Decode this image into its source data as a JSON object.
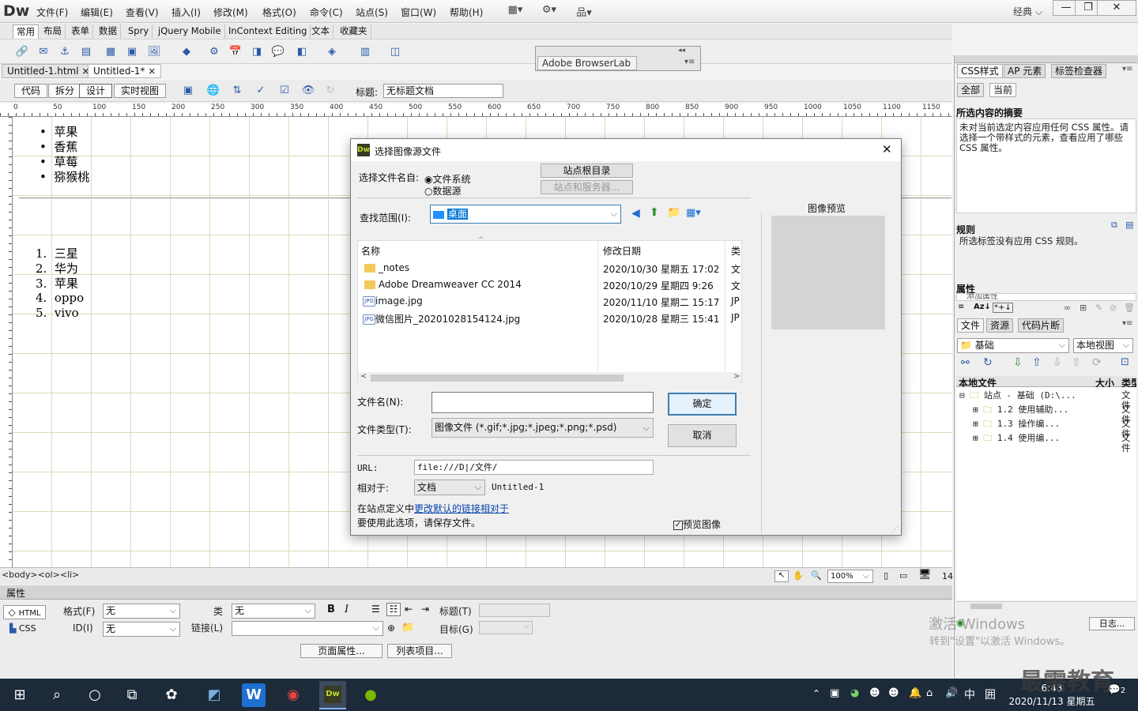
{
  "app": {
    "logo": "Dw",
    "menu": [
      "文件(F)",
      "编辑(E)",
      "查看(V)",
      "插入(I)",
      "修改(M)",
      "格式(O)",
      "命令(C)",
      "站点(S)",
      "窗口(W)",
      "帮助(H)"
    ],
    "workspace": "经典",
    "win_min": "—",
    "win_max": "❐",
    "win_close": "✕"
  },
  "insert_tabs": [
    "常用",
    "布局",
    "表单",
    "数据",
    "Spry",
    "jQuery Mobile",
    "InContext Editing",
    "文本",
    "收藏夹"
  ],
  "doc_tabs": [
    {
      "label": "Untitled-1.html",
      "close": "×"
    },
    {
      "label": "Untitled-1*",
      "close": "×"
    }
  ],
  "view_buttons": [
    "代码",
    "拆分",
    "设计",
    "实时视图"
  ],
  "title_label": "标题:",
  "title_value": "无标题文档",
  "ruler_labels": [
    "0",
    "50",
    "100",
    "150",
    "200",
    "250",
    "300",
    "350",
    "400",
    "450",
    "500",
    "550",
    "600",
    "650",
    "700",
    "750",
    "800",
    "850",
    "900",
    "950",
    "1000",
    "1050",
    "1100",
    "1150"
  ],
  "browserlab": {
    "title": "Adobe BrowserLab",
    "collapse": "◂◂",
    "menu": "▾≡"
  },
  "doc": {
    "ul": [
      "苹果",
      "香蕉",
      "草莓",
      "猕猴桃"
    ],
    "ol": [
      "三星",
      "华为",
      "苹果",
      "oppo",
      "vivo"
    ]
  },
  "status": {
    "tagpath": "<body><ol><li>",
    "zoom": "100%",
    "size": "14"
  },
  "props": {
    "header": "属性",
    "html_btn": "HTML",
    "css_btn": "CSS",
    "format_label": "格式(F)",
    "format_value": "无",
    "id_label": "ID(I)",
    "id_value": "无",
    "class_label": "类",
    "class_value": "无",
    "link_label": "链接(L)",
    "link_value": "",
    "title_label": "标题(T)",
    "target_label": "目标(G)",
    "bold": "B",
    "italic": "I",
    "page_props": "页面属性...",
    "list_item": "列表项目..."
  },
  "right": {
    "css_tabs": [
      "CSS样式",
      "AP 元素",
      "标签检查器"
    ],
    "mode_tabs": [
      "全部",
      "当前"
    ],
    "summary_head": "所选内容的摘要",
    "summary_text": "未对当前选定内容应用任何 CSS 属性。请选择一个带样式的元素，查看应用了哪些 CSS 属性。",
    "rules_head": "规则",
    "rules_text": "所选标签没有应用 CSS 规则。",
    "attr_head": "属性",
    "attr_add": "添加属性",
    "files_tabs": [
      "文件",
      "资源",
      "代码片断"
    ],
    "site_select": "基础",
    "view_select": "本地视图",
    "local_files": "本地文件",
    "size_col": "大小",
    "type_col": "类型",
    "tree": [
      {
        "name": "站点 - 基础 (D:\\...",
        "type": "文件"
      },
      {
        "name": "1.2 使用辅助...",
        "type": "文件"
      },
      {
        "name": "1.3 操作编...",
        "type": "文件"
      },
      {
        "name": "1.4 使用编...",
        "type": "文件"
      }
    ],
    "log": "日志..."
  },
  "dialog": {
    "title": "选择图像源文件",
    "close": "✕",
    "select_label": "选择文件名自:",
    "opt_fs": "文件系统",
    "opt_ds": "数据源",
    "site_root": "站点根目录",
    "site_server": "站点和服务器...",
    "lookin_label": "查找范围(I):",
    "lookin_value": "桌面",
    "col_name": "名称",
    "col_date": "修改日期",
    "col_type": "类",
    "files": [
      {
        "name": "_notes",
        "date": "2020/10/30 星期五 17:02",
        "type": "文",
        "kind": "folder"
      },
      {
        "name": "Adobe Dreamweaver CC 2014",
        "date": "2020/10/29 星期四 9:26",
        "type": "文",
        "kind": "folder"
      },
      {
        "name": "image.jpg",
        "date": "2020/11/10 星期二 15:17",
        "type": "JP",
        "kind": "jpg"
      },
      {
        "name": "微信图片_20201028154124.jpg",
        "date": "2020/10/28 星期三 15:41",
        "type": "JP",
        "kind": "jpg"
      }
    ],
    "filename_label": "文件名(N):",
    "filename_value": "",
    "filetype_label": "文件类型(T):",
    "filetype_value": "图像文件 (*.gif;*.jpg;*.jpeg;*.png;*.psd)",
    "ok": "确定",
    "cancel": "取消",
    "url_label": "URL:",
    "url_value": "file:///D|/文件/",
    "relative_label": "相对于:",
    "relative_value": "文档",
    "relative_doc": "Untitled-1",
    "site_def_prefix": "在站点定义中",
    "site_def_link": "更改默认的链接相对于",
    "save_note": "要使用此选项，请保存文件。",
    "preview_label": "预览图像",
    "preview_title": "图像预览",
    "jpg_badge": "JPG"
  },
  "overlay": {
    "activate1": "激活 Windows",
    "activate2": "转到\"设置\"以激活 Windows。",
    "watermark": "最需教育"
  },
  "taskbar": {
    "time": "6:43",
    "date": "2020/11/13 星期五",
    "ime": "中",
    "ime2": "囲",
    "notif": "2"
  }
}
